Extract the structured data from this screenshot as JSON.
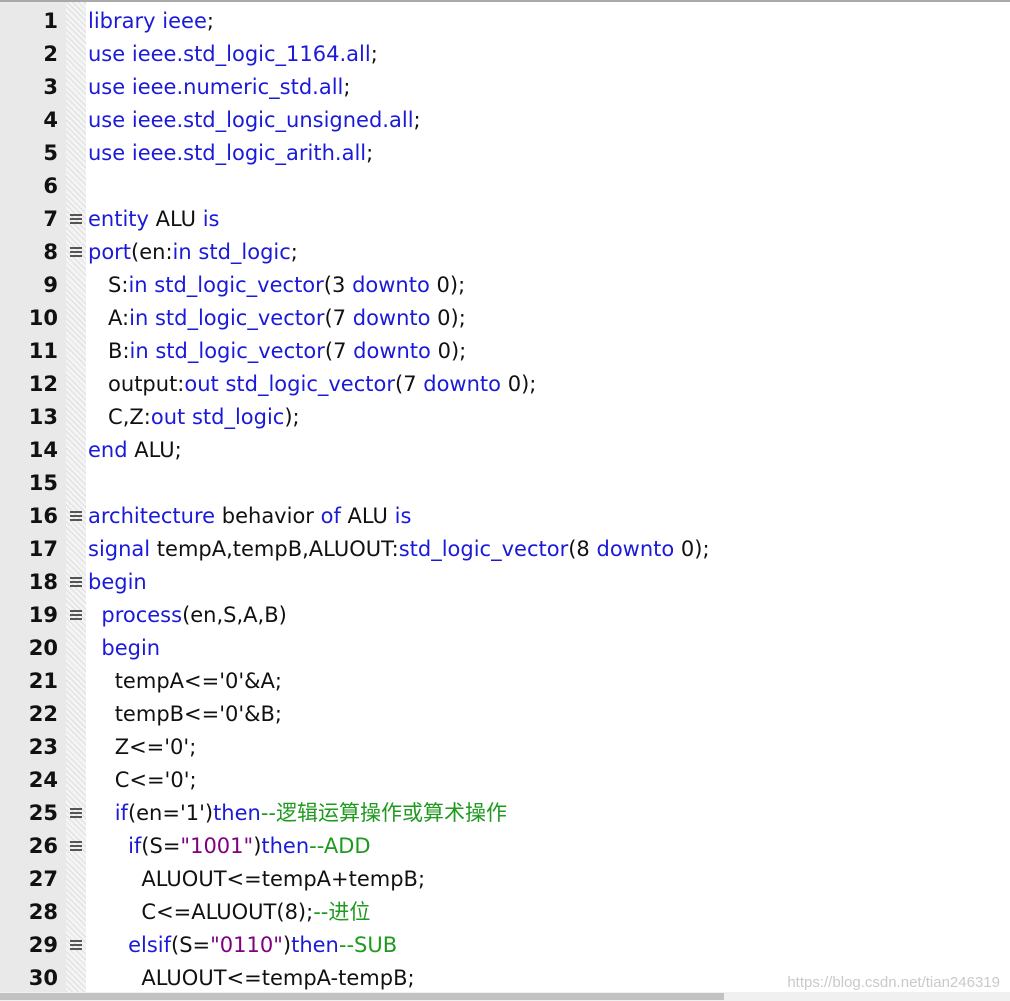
{
  "editor": {
    "lines": [
      {
        "n": "1",
        "fold": false,
        "indent": "",
        "tokens": [
          [
            "kw",
            "library"
          ],
          [
            "id",
            " "
          ],
          [
            "kw",
            "ieee"
          ],
          [
            "id",
            ";"
          ]
        ]
      },
      {
        "n": "2",
        "fold": false,
        "indent": "",
        "tokens": [
          [
            "kw",
            "use"
          ],
          [
            "id",
            " "
          ],
          [
            "kw",
            "ieee.std_logic_1164.all"
          ],
          [
            "id",
            ";"
          ]
        ]
      },
      {
        "n": "3",
        "fold": false,
        "indent": "",
        "tokens": [
          [
            "kw",
            "use"
          ],
          [
            "id",
            " "
          ],
          [
            "kw",
            "ieee.numeric_std.all"
          ],
          [
            "id",
            ";"
          ]
        ]
      },
      {
        "n": "4",
        "fold": false,
        "indent": "",
        "tokens": [
          [
            "kw",
            "use"
          ],
          [
            "id",
            " "
          ],
          [
            "kw",
            "ieee.std_logic_unsigned.all"
          ],
          [
            "id",
            ";"
          ]
        ]
      },
      {
        "n": "5",
        "fold": false,
        "indent": "",
        "tokens": [
          [
            "kw",
            "use"
          ],
          [
            "id",
            " "
          ],
          [
            "kw",
            "ieee.std_logic_arith.all"
          ],
          [
            "id",
            ";"
          ]
        ]
      },
      {
        "n": "6",
        "fold": false,
        "indent": "",
        "tokens": []
      },
      {
        "n": "7",
        "fold": true,
        "indent": "",
        "tokens": [
          [
            "kw",
            "entity"
          ],
          [
            "id",
            " ALU "
          ],
          [
            "kw",
            "is"
          ]
        ]
      },
      {
        "n": "8",
        "fold": true,
        "indent": "",
        "tokens": [
          [
            "kw",
            "port"
          ],
          [
            "id",
            "(en:"
          ],
          [
            "kw",
            "in"
          ],
          [
            "id",
            " "
          ],
          [
            "kw",
            "std_logic"
          ],
          [
            "id",
            ";"
          ]
        ]
      },
      {
        "n": "9",
        "fold": false,
        "indent": "   ",
        "tokens": [
          [
            "id",
            "S:"
          ],
          [
            "kw",
            "in"
          ],
          [
            "id",
            " "
          ],
          [
            "kw",
            "std_logic_vector"
          ],
          [
            "id",
            "("
          ],
          [
            "num",
            "3"
          ],
          [
            "id",
            " "
          ],
          [
            "kw",
            "downto"
          ],
          [
            "id",
            " "
          ],
          [
            "num",
            "0"
          ],
          [
            "id",
            ");"
          ]
        ]
      },
      {
        "n": "10",
        "fold": false,
        "indent": "   ",
        "tokens": [
          [
            "id",
            "A:"
          ],
          [
            "kw",
            "in"
          ],
          [
            "id",
            " "
          ],
          [
            "kw",
            "std_logic_vector"
          ],
          [
            "id",
            "("
          ],
          [
            "num",
            "7"
          ],
          [
            "id",
            " "
          ],
          [
            "kw",
            "downto"
          ],
          [
            "id",
            " "
          ],
          [
            "num",
            "0"
          ],
          [
            "id",
            ");"
          ]
        ]
      },
      {
        "n": "11",
        "fold": false,
        "indent": "   ",
        "tokens": [
          [
            "id",
            "B:"
          ],
          [
            "kw",
            "in"
          ],
          [
            "id",
            " "
          ],
          [
            "kw",
            "std_logic_vector"
          ],
          [
            "id",
            "("
          ],
          [
            "num",
            "7"
          ],
          [
            "id",
            " "
          ],
          [
            "kw",
            "downto"
          ],
          [
            "id",
            " "
          ],
          [
            "num",
            "0"
          ],
          [
            "id",
            ");"
          ]
        ]
      },
      {
        "n": "12",
        "fold": false,
        "indent": "   ",
        "tokens": [
          [
            "id",
            "output:"
          ],
          [
            "kw",
            "out"
          ],
          [
            "id",
            " "
          ],
          [
            "kw",
            "std_logic_vector"
          ],
          [
            "id",
            "("
          ],
          [
            "num",
            "7"
          ],
          [
            "id",
            " "
          ],
          [
            "kw",
            "downto"
          ],
          [
            "id",
            " "
          ],
          [
            "num",
            "0"
          ],
          [
            "id",
            ");"
          ]
        ]
      },
      {
        "n": "13",
        "fold": false,
        "indent": "   ",
        "tokens": [
          [
            "id",
            "C,Z:"
          ],
          [
            "kw",
            "out"
          ],
          [
            "id",
            " "
          ],
          [
            "kw",
            "std_logic"
          ],
          [
            "id",
            ");"
          ]
        ]
      },
      {
        "n": "14",
        "fold": false,
        "indent": "",
        "tokens": [
          [
            "kw",
            "end"
          ],
          [
            "id",
            " ALU;"
          ]
        ]
      },
      {
        "n": "15",
        "fold": false,
        "indent": "",
        "tokens": []
      },
      {
        "n": "16",
        "fold": true,
        "indent": "",
        "tokens": [
          [
            "kw",
            "architecture"
          ],
          [
            "id",
            " behavior "
          ],
          [
            "kw",
            "of"
          ],
          [
            "id",
            " ALU "
          ],
          [
            "kw",
            "is"
          ]
        ]
      },
      {
        "n": "17",
        "fold": false,
        "indent": "",
        "tokens": [
          [
            "kw",
            "signal"
          ],
          [
            "id",
            " tempA,tempB,ALUOUT:"
          ],
          [
            "kw",
            "std_logic_vector"
          ],
          [
            "id",
            "("
          ],
          [
            "num",
            "8"
          ],
          [
            "id",
            " "
          ],
          [
            "kw",
            "downto"
          ],
          [
            "id",
            " "
          ],
          [
            "num",
            "0"
          ],
          [
            "id",
            ");"
          ]
        ]
      },
      {
        "n": "18",
        "fold": true,
        "indent": "",
        "tokens": [
          [
            "kw",
            "begin"
          ]
        ]
      },
      {
        "n": "19",
        "fold": true,
        "indent": "  ",
        "tokens": [
          [
            "kw",
            "process"
          ],
          [
            "id",
            "(en,S,A,B)"
          ]
        ]
      },
      {
        "n": "20",
        "fold": false,
        "indent": "  ",
        "tokens": [
          [
            "kw",
            "begin"
          ]
        ]
      },
      {
        "n": "21",
        "fold": false,
        "indent": "    ",
        "tokens": [
          [
            "id",
            "tempA<='0'&A;"
          ]
        ]
      },
      {
        "n": "22",
        "fold": false,
        "indent": "    ",
        "tokens": [
          [
            "id",
            "tempB<='0'&B;"
          ]
        ]
      },
      {
        "n": "23",
        "fold": false,
        "indent": "    ",
        "tokens": [
          [
            "id",
            "Z<='0';"
          ]
        ]
      },
      {
        "n": "24",
        "fold": false,
        "indent": "    ",
        "tokens": [
          [
            "id",
            "C<='0';"
          ]
        ]
      },
      {
        "n": "25",
        "fold": true,
        "indent": "    ",
        "tokens": [
          [
            "kw",
            "if"
          ],
          [
            "id",
            "(en='1')"
          ],
          [
            "kw",
            "then"
          ],
          [
            "cmt",
            "--逻辑运算操作或算术操作"
          ]
        ]
      },
      {
        "n": "26",
        "fold": true,
        "indent": "      ",
        "tokens": [
          [
            "kw",
            "if"
          ],
          [
            "id",
            "(S="
          ],
          [
            "str",
            "\"1001\""
          ],
          [
            "id",
            ")"
          ],
          [
            "kw",
            "then"
          ],
          [
            "cmt",
            "--ADD"
          ]
        ]
      },
      {
        "n": "27",
        "fold": false,
        "indent": "        ",
        "tokens": [
          [
            "id",
            "ALUOUT<=tempA+tempB;"
          ]
        ]
      },
      {
        "n": "28",
        "fold": false,
        "indent": "        ",
        "tokens": [
          [
            "id",
            "C<=ALUOUT(8);"
          ],
          [
            "cmt",
            "--进位"
          ]
        ]
      },
      {
        "n": "29",
        "fold": true,
        "indent": "      ",
        "tokens": [
          [
            "kw",
            "elsif"
          ],
          [
            "id",
            "(S="
          ],
          [
            "str",
            "\"0110\""
          ],
          [
            "id",
            ")"
          ],
          [
            "kw",
            "then"
          ],
          [
            "cmt",
            "--SUB"
          ]
        ]
      },
      {
        "n": "30",
        "fold": false,
        "indent": "        ",
        "tokens": [
          [
            "id",
            "ALUOUT<=tempA-tempB;"
          ]
        ]
      }
    ]
  },
  "watermark": "https://blog.csdn.net/tian246319",
  "colors": {
    "keyword": "#1a1ad8",
    "identifier": "#111111",
    "string": "#800080",
    "comment": "#1e9a1e",
    "gutter": "#e9e9e9"
  }
}
